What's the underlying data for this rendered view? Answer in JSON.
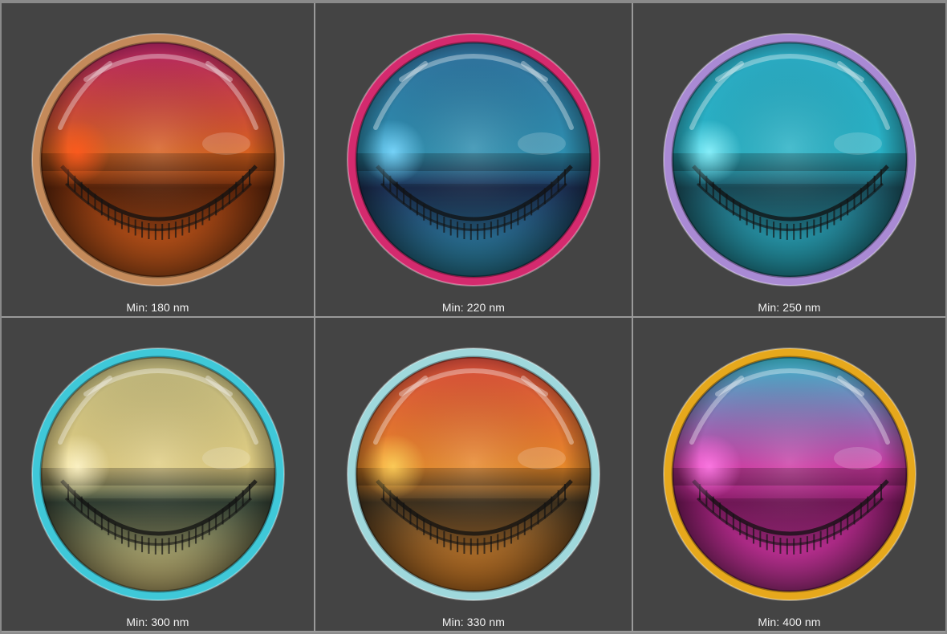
{
  "panels": [
    {
      "label": "Min: 180 nm",
      "rim": "#c48a5a",
      "top": "#b32463",
      "mid": "#d8621e",
      "bottom": "#6a2a0c",
      "glow": "#ff5a1e"
    },
    {
      "label": "Min: 220 nm",
      "rim": "#d42a6e",
      "top": "#2f6f9a",
      "mid": "#2e8fb0",
      "bottom": "#1e3258",
      "glow": "#7ad8ff"
    },
    {
      "label": "Min: 250 nm",
      "rim": "#a98ad4",
      "top": "#2aa8c0",
      "mid": "#29b2c6",
      "bottom": "#1e5a6a",
      "glow": "#8cf4ff"
    },
    {
      "label": "Min: 300 nm",
      "rim": "#3fc8d8",
      "top": "#b8b078",
      "mid": "#e2cf84",
      "bottom": "#3a4a3c",
      "glow": "#fff5c8"
    },
    {
      "label": "Min: 330 nm",
      "rim": "#9fd8dc",
      "top": "#d44a3a",
      "mid": "#e88a2a",
      "bottom": "#4a3a24",
      "glow": "#ffcf5a"
    },
    {
      "label": "Min: 400 nm",
      "rim": "#e6a81c",
      "top": "#3ab4c8",
      "mid": "#d43aa6",
      "bottom": "#8a1c6a",
      "glow": "#ff7ae6"
    }
  ]
}
